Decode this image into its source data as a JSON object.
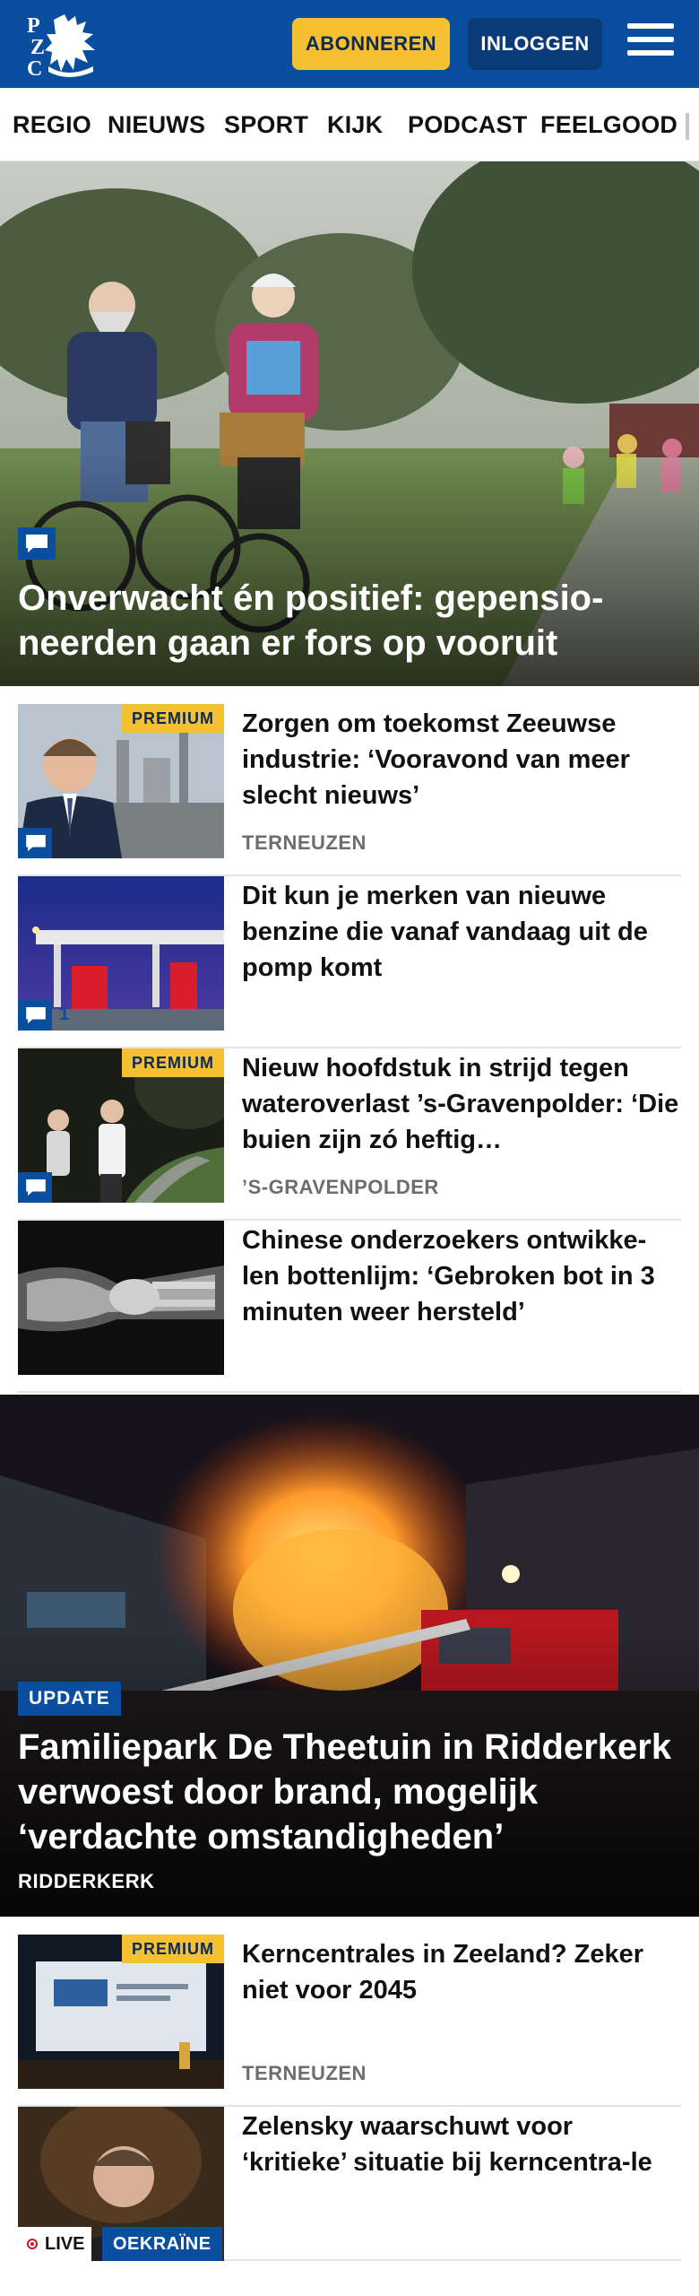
{
  "header": {
    "subscribe_label": "ABONNEREN",
    "login_label": "INLOGGEN",
    "brand_color": "#0a4ea0",
    "accent_color": "#f5c132"
  },
  "nav": {
    "items": [
      "REGIO",
      "NIEUWS",
      "SPORT",
      "KIJK",
      "PODCAST",
      "FEELGOOD"
    ]
  },
  "hero": {
    "title": "Onverwacht én positief: gepensio-neerden gaan er fors op vooruit",
    "icon": "comment-icon"
  },
  "articles": [
    {
      "title": "Zorgen om toekomst Zeeuwse industrie: ‘Vooravond van meer slecht nieuws’",
      "location": "TERNEUZEN",
      "badge": "PREMIUM",
      "icon": "comment-icon"
    },
    {
      "title": "Dit kun je merken van nieuwe benzine die vanaf vandaag uit de pomp komt",
      "comment_count": "1",
      "icon": "comment-icon"
    },
    {
      "title": "Nieuw hoofdstuk in strijd tegen wateroverlast ’s-Gravenpolder: ‘Die buien zijn zó heftig…",
      "location": "’S-GRAVENPOLDER",
      "badge": "PREMIUM",
      "icon": "comment-icon"
    },
    {
      "title": "Chinese onderzoekers ontwikke-len bottenlijm: ‘Gebroken bot in 3 minuten weer hersteld’"
    }
  ],
  "feature": {
    "tag": "UPDATE",
    "title": "Familiepark De Theetuin in Ridderkerk verwoest door brand, mogelijk ‘verdachte omstandigheden’",
    "location": "RIDDERKERK"
  },
  "articles2": [
    {
      "title": "Kerncentrales in Zeeland? Zeker niet voor 2045",
      "location": "TERNEUZEN",
      "badge": "PREMIUM"
    },
    {
      "title": "Zelensky waarschuwt voor ‘kritieke’ situatie bij kerncentra-le",
      "live_label": "LIVE",
      "topic": "OEKRAÏNE"
    }
  ]
}
